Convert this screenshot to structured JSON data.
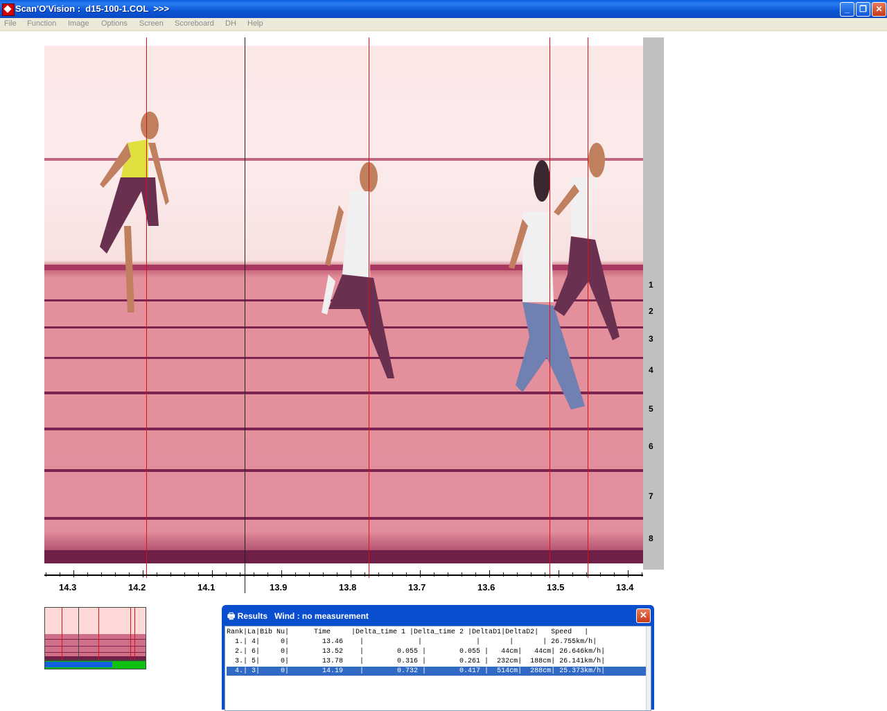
{
  "window": {
    "title": "Scan'O'Vision :  d15-100-1.COL  >>>"
  },
  "menu": [
    "File",
    "Function",
    "Image",
    "Options",
    "Screen",
    "Scoreboard",
    "DH",
    "Help"
  ],
  "lanes": [
    "1",
    "2",
    "3",
    "4",
    "5",
    "6",
    "7",
    "8"
  ],
  "axis_labels": [
    "14.3",
    "14.2",
    "14.1",
    "13.9",
    "13.8",
    "13.7",
    "13.6",
    "13.5",
    "13.4"
  ],
  "thumbnail": {
    "progress_fraction": 0.67
  },
  "results": {
    "title": "Results   Wind : no measurement",
    "header": "Rank|La|Bib Nu|      Time     |Delta_time 1 |Delta_time 2 |DeltaD1|DeltaD2|   Speed   |",
    "rows": [
      "  1.| 4|     0|        13.46    |             |             |       |       | 26.755km/h|",
      "  2.| 6|     0|        13.52    |        0.055 |        0.055 |   44cm|   44cm| 26.646km/h|",
      "  3.| 5|     0|        13.78    |        0.316 |        0.261 |  232cm|  188cm| 26.141km/h|",
      "  4.| 3|     0|        14.19    |        0.732 |        0.417 |  514cm|  288cm| 25.373km/h|"
    ]
  },
  "colors": {
    "track": "#e38e9c",
    "finish_line": "#e01010",
    "title_bar": "#0a55d6",
    "selection": "#316ac5"
  }
}
